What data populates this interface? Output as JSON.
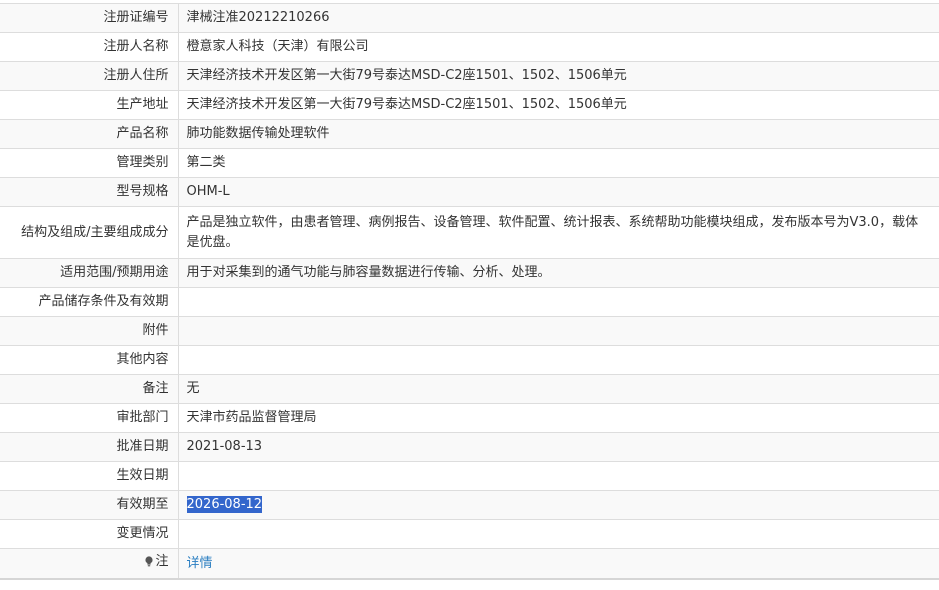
{
  "rows": [
    {
      "label": "注册证编号",
      "value": "津械注准20212210266"
    },
    {
      "label": "注册人名称",
      "value": "橙意家人科技（天津）有限公司"
    },
    {
      "label": "注册人住所",
      "value": "天津经济技术开发区第一大街79号泰达MSD-C2座1501、1502、1506单元"
    },
    {
      "label": "生产地址",
      "value": "天津经济技术开发区第一大街79号泰达MSD-C2座1501、1502、1506单元"
    },
    {
      "label": "产品名称",
      "value": "肺功能数据传输处理软件"
    },
    {
      "label": "管理类别",
      "value": "第二类"
    },
    {
      "label": "型号规格",
      "value": "OHM-L"
    },
    {
      "label": "结构及组成/主要组成成分",
      "value": "产品是独立软件，由患者管理、病例报告、设备管理、软件配置、统计报表、系统帮助功能模块组成，发布版本号为V3.0，载体是优盘。"
    },
    {
      "label": "适用范围/预期用途",
      "value": "用于对采集到的通气功能与肺容量数据进行传输、分析、处理。"
    },
    {
      "label": "产品储存条件及有效期",
      "value": ""
    },
    {
      "label": "附件",
      "value": ""
    },
    {
      "label": "其他内容",
      "value": ""
    },
    {
      "label": "备注",
      "value": "无"
    },
    {
      "label": "审批部门",
      "value": "天津市药品监督管理局"
    },
    {
      "label": "批准日期",
      "value": "2021-08-13"
    },
    {
      "label": "生效日期",
      "value": ""
    },
    {
      "label": "有效期至",
      "value": "2026-08-12"
    },
    {
      "label": "变更情况",
      "value": ""
    }
  ],
  "note": {
    "icon": "bulb-icon",
    "label": "注",
    "link_text": "详情"
  },
  "colors": {
    "link": "#2a7ec1",
    "selection": "#3366cc",
    "stripe": "#f9f9f9",
    "border": "#dddddd"
  }
}
